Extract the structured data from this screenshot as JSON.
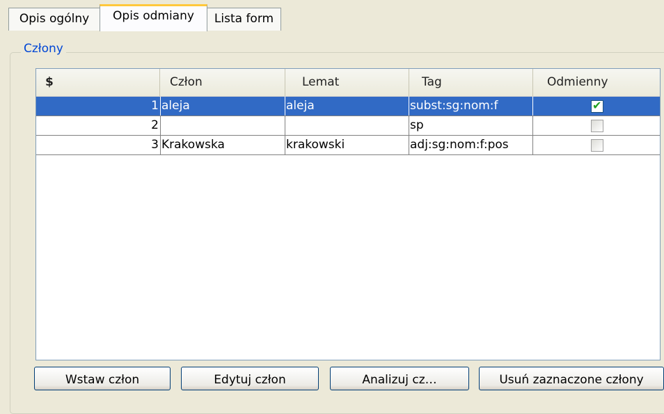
{
  "tabs": [
    {
      "label": "Opis ogólny"
    },
    {
      "label": "Opis odmiany",
      "active": true
    },
    {
      "label": "Lista form"
    }
  ],
  "group": {
    "title": "Człony"
  },
  "table": {
    "columns": [
      "$",
      "Człon",
      "Lemat",
      "Tag",
      "Odmienny"
    ],
    "rows": [
      {
        "num": "1",
        "czlon": "aleja",
        "lemat": "aleja",
        "tag": "subst:sg:nom:f",
        "odmienny": true,
        "selected": true
      },
      {
        "num": "2",
        "czlon": "",
        "lemat": "",
        "tag": "sp",
        "odmienny": false,
        "selected": false
      },
      {
        "num": "3",
        "czlon": "Krakowska",
        "lemat": "krakowski",
        "tag": "adj:sg:nom:f:pos",
        "odmienny": false,
        "selected": false
      }
    ]
  },
  "buttons": {
    "insert": "Wstaw człon",
    "edit": "Edytuj człon",
    "analyze": "Analizuj cz…",
    "remove": "Usuń zaznaczone człony"
  },
  "colors": {
    "selection": "#316ac5",
    "group_title": "#0046d5",
    "active_tab_accent": "#ffc83c",
    "checkmark": "#21a121"
  }
}
